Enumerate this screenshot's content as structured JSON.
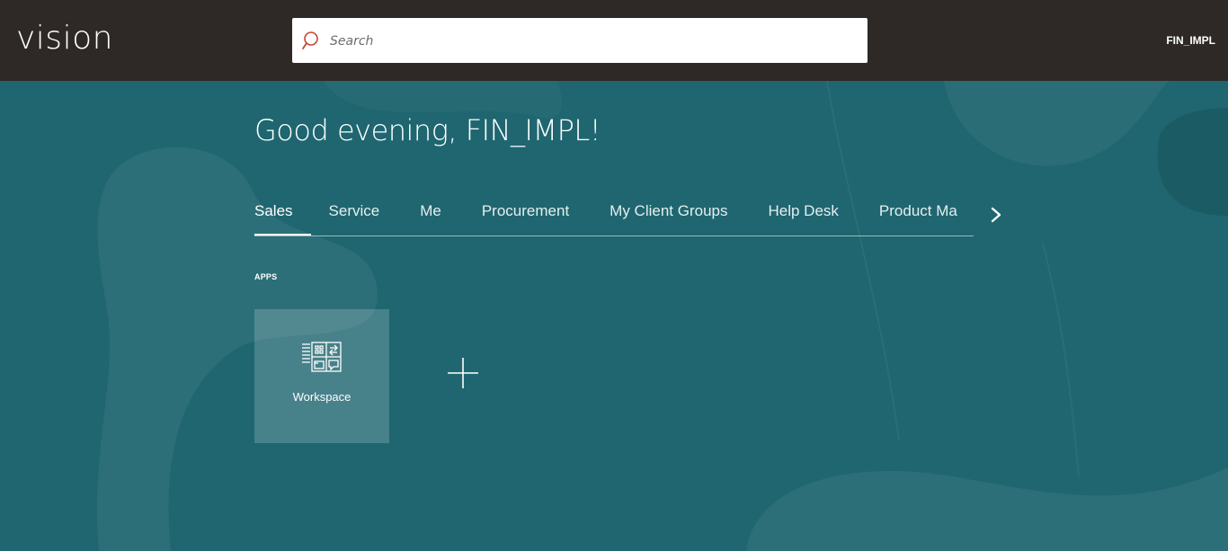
{
  "header": {
    "logo_text": "vision",
    "search": {
      "placeholder": "Search",
      "value": ""
    },
    "user_name": "FIN_IMPL"
  },
  "main": {
    "greeting": "Good evening, FIN_IMPL!",
    "tabs": [
      {
        "label": "Sales",
        "active": true
      },
      {
        "label": "Service"
      },
      {
        "label": "Me"
      },
      {
        "label": "Procurement"
      },
      {
        "label": "My Client Groups"
      },
      {
        "label": "Help Desk"
      },
      {
        "label": "Product Ma"
      }
    ],
    "apps_heading": "APPS",
    "apps": [
      {
        "label": "Workspace",
        "icon": "workspace-icon"
      }
    ],
    "add_icon": "plus-icon",
    "next_icon": "chevron-right-icon"
  },
  "colors": {
    "header_bg": "#2e2926",
    "main_bg": "#1f6670",
    "search_icon": "#c74634"
  }
}
